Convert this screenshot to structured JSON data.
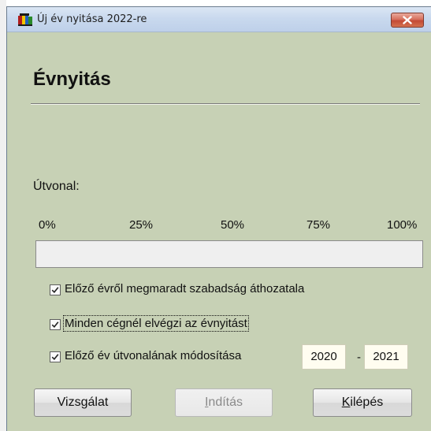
{
  "window": {
    "title": "Új év nyitása 2022-re",
    "icon": "app-logo-icon",
    "close_icon": "close-icon"
  },
  "main": {
    "heading": "Évnyitás",
    "path_label": "Útvonal:",
    "progress": {
      "ticks": [
        "0%",
        "25%",
        "50%",
        "75%",
        "100%"
      ],
      "value_percent": 0
    }
  },
  "options": [
    {
      "label": "Előző évről megmaradt szabadság áthozatala",
      "checked": true
    },
    {
      "label": "Minden cégnél elvégzi az évnyitást",
      "checked": true
    },
    {
      "label": "Előző év útvonalának módosítása",
      "checked": true
    }
  ],
  "years": {
    "from": "2020",
    "separator": "-",
    "to": "2021"
  },
  "buttons": {
    "check": "Vizsgálat",
    "start_prefix": "",
    "start_mnemonic": "I",
    "start_rest": "ndítás",
    "exit_prefix": "",
    "exit_mnemonic": "K",
    "exit_rest": "ilépés"
  },
  "colors": {
    "dialog_background": "#c7d1b5",
    "close_button": "#c44a35"
  }
}
